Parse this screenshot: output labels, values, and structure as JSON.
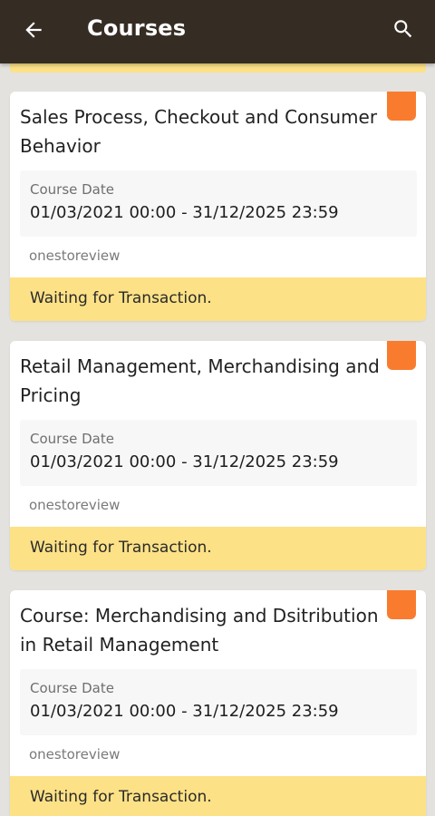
{
  "header": {
    "title": "Courses",
    "back_icon": "arrow-left-icon",
    "search_icon": "search-icon",
    "background_color": "#352c24"
  },
  "colors": {
    "accent_flag": "#f97c2e",
    "status_bar": "#fde186",
    "page_background": "#e4e2de"
  },
  "courses": [
    {
      "title": "Sales Process, Checkout and Consumer Behavior",
      "date_label": "Course Date",
      "date_value": "01/03/2021 00:00 - 31/12/2025 23:59",
      "organization": "onestoreview",
      "status": "Waiting for Transaction."
    },
    {
      "title": "Retail Management, Merchandising and Pricing",
      "date_label": "Course Date",
      "date_value": "01/03/2021 00:00 - 31/12/2025 23:59",
      "organization": "onestoreview",
      "status": "Waiting for Transaction."
    },
    {
      "title": "Course: Merchandising and Dsitribution in Retail Management",
      "date_label": "Course Date",
      "date_value": "01/03/2021 00:00 - 31/12/2025 23:59",
      "organization": "onestoreview",
      "status": "Waiting for Transaction."
    }
  ]
}
